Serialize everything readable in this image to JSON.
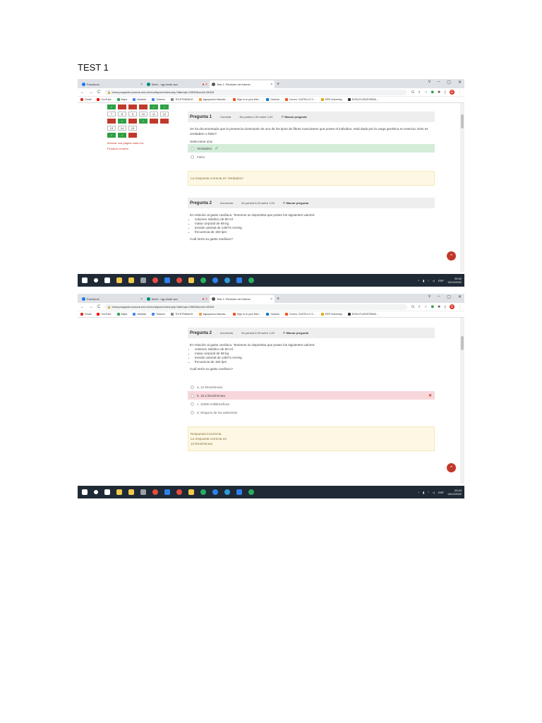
{
  "document": {
    "title": "TEST 1"
  },
  "browser": {
    "tabs": [
      {
        "label": "Facebook",
        "color": "#1877f2"
      },
      {
        "label": "Meet - rqg dmah acn",
        "color": "#00897b"
      },
      {
        "label": "Test 1: Revisión del intento",
        "color": "#555555"
      }
    ],
    "new_tab": "+",
    "window_controls": [
      "v",
      "–",
      "▢",
      "✕"
    ],
    "url": "evea.posgrado.ucacue.edu.ec/mod/quiz/review.php?attempt=15549&cmid=34534",
    "profile_initial": "G",
    "bookmarks": [
      {
        "label": "Gmail",
        "color": "#d93025"
      },
      {
        "label": "YouTube",
        "color": "#ff0000"
      },
      {
        "label": "Maps",
        "color": "#34a853"
      },
      {
        "label": "Noticias",
        "color": "#4285f4"
      },
      {
        "label": "Traducir",
        "color": "#4285f4"
      },
      {
        "label": "TELETRABAJO",
        "color": "#888888"
      },
      {
        "label": "Agrupación Manota...",
        "color": "#f2994a"
      },
      {
        "label": "Sign in to your Micr...",
        "color": "#f25022"
      },
      {
        "label": "Outlook",
        "color": "#0078d4"
      },
      {
        "label": "Correo: CASTILLO S...",
        "color": "#f25022"
      },
      {
        "label": "ERP University",
        "color": "#e6a700"
      },
      {
        "label": "EVEA PLATAFORMA...",
        "color": "#333333"
      }
    ]
  },
  "quiz_nav": {
    "rows": [
      [
        {
          "n": "",
          "s": "g"
        },
        {
          "n": "",
          "s": "r"
        },
        {
          "n": "",
          "s": "r"
        },
        {
          "n": "",
          "s": "r"
        },
        {
          "n": "",
          "s": "g"
        },
        {
          "n": "",
          "s": "g"
        }
      ],
      [
        {
          "n": "7",
          "s": "w"
        },
        {
          "n": "8",
          "s": "w"
        },
        {
          "n": "9",
          "s": "w"
        },
        {
          "n": "10",
          "s": "w"
        },
        {
          "n": "11",
          "s": "w"
        },
        {
          "n": "12",
          "s": "w"
        }
      ],
      [
        {
          "n": "",
          "s": "r"
        },
        {
          "n": "",
          "s": "g"
        },
        {
          "n": "",
          "s": "r"
        },
        {
          "n": "",
          "s": "g"
        },
        {
          "n": "",
          "s": "r"
        },
        {
          "n": "",
          "s": "r"
        }
      ],
      [
        {
          "n": "13",
          "s": "w"
        },
        {
          "n": "14",
          "s": "w"
        },
        {
          "n": "15",
          "s": "w"
        }
      ],
      [
        {
          "n": "",
          "s": "g"
        },
        {
          "n": "",
          "s": "g"
        },
        {
          "n": "",
          "s": "r"
        }
      ]
    ],
    "show_one_page": "Mostrar una página cada vez",
    "finish_review": "Finalizar revisión"
  },
  "q1": {
    "title": "Pregunta 1",
    "status": "Correcta",
    "score": "Se puntúa 1,00 sobre 1,00",
    "flag": "Marcar pregunta",
    "text": "Se ha documentado que la presencia dominante de uno de los tipos de fibras musculares que posee el individuo, está dada por la carga genética en esencia. Esto es verdadero o falso?",
    "select_one": "Seleccione una:",
    "options": [
      "Verdadero",
      "Falso"
    ],
    "feedback": "La respuesta correcta es 'Verdadero'"
  },
  "q2": {
    "title": "Pregunta 2",
    "status": "Incorrecta",
    "score": "Se puntúa 0,00 sobre 1,00",
    "flag": "Marcar pregunta",
    "text": "En relación al gasto cardíaco. Tenemos un deportista que posee los siguientes valores:",
    "bullets": [
      "volumen sistólico de 80 ml",
      "masa corporal de 68 kg",
      "tensión arterial de 128/74 mmHg",
      "frecuencia de 150 lpm"
    ],
    "question": "Cuál sería su gasto cardíaco?",
    "options": [
      "a. 12 litros/minuto",
      "b. 10,2 litros/minuto",
      "c. 12000 mililitros/hora",
      "d. Ninguno de los anteriores"
    ],
    "feedback_title": "Respuesta incorrecta.",
    "feedback_label": "La respuesta correcta es:",
    "feedback_answer": "12 litros/minuto"
  },
  "taskbar": {
    "icons": [
      "#ffffff",
      "#ffffff",
      "#ffffff",
      "#f2c94c",
      "#f2c94c",
      "#9aa0a6",
      "#e74c3c",
      "#2f80ed",
      "#e74c3c",
      "#f2c94c",
      "#27ae60",
      "#2f80ed",
      "#2d9cdb",
      "#2f80ed",
      "#27ae60"
    ],
    "lang": "ESP",
    "shot1_time": "20:42",
    "shot2_time": "20:43",
    "date": "13/12/2022"
  }
}
